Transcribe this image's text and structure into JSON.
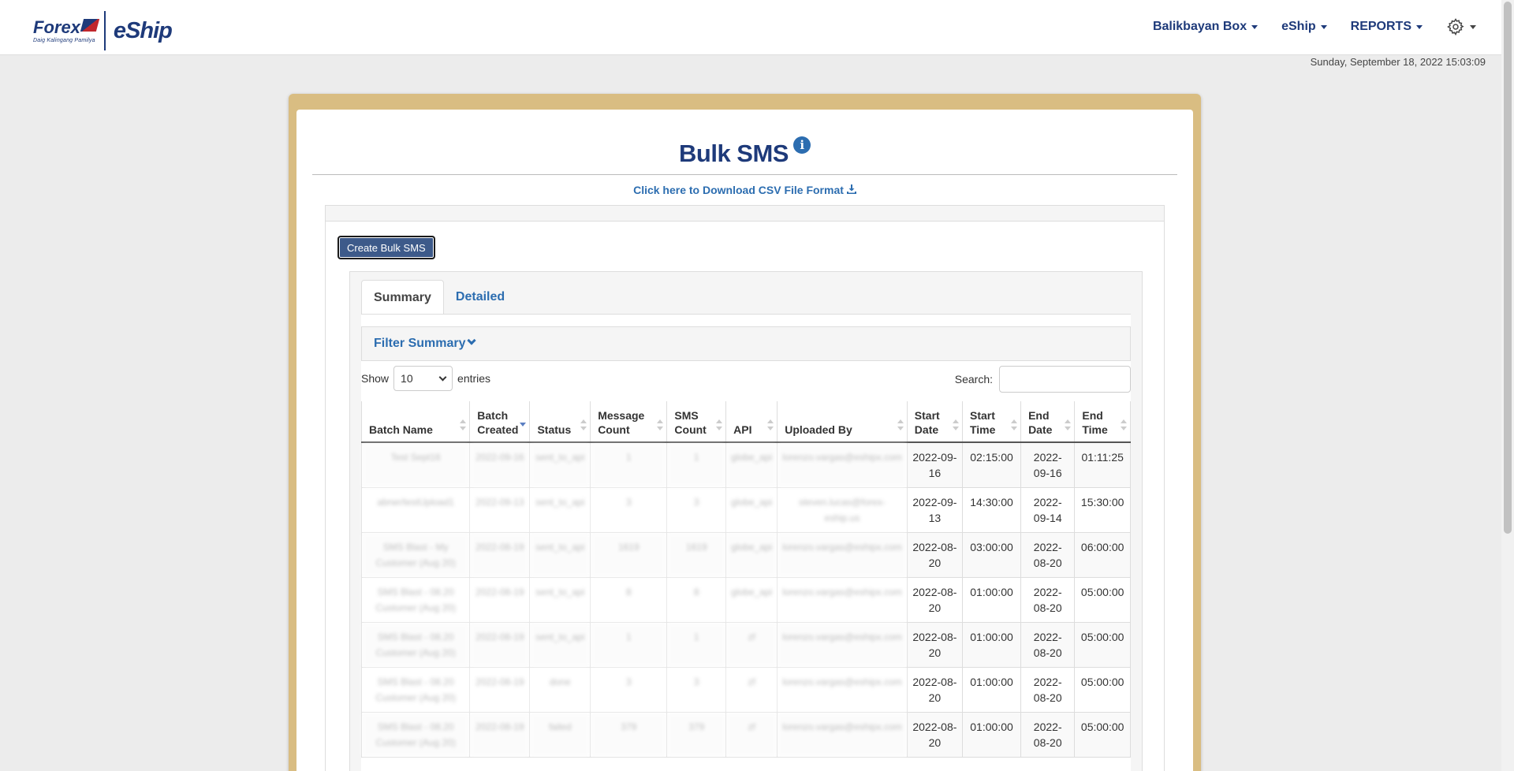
{
  "navbar": {
    "logo_forex": "Forex",
    "logo_tagline": "Daig Kalingang Pamilya",
    "logo_eship": "eShip",
    "menu": [
      {
        "label": "Balikbayan Box"
      },
      {
        "label": "eShip"
      },
      {
        "label": "REPORTS"
      }
    ]
  },
  "datetime": "Sunday, September 18, 2022 15:03:09",
  "page": {
    "title": "Bulk SMS",
    "csv_link": "Click here to Download CSV File Format",
    "create_button": "Create Bulk SMS"
  },
  "tabs": [
    {
      "label": "Summary",
      "active": true
    },
    {
      "label": "Detailed",
      "active": false
    }
  ],
  "filter": {
    "label": "Filter Summary"
  },
  "length_menu": {
    "show": "Show",
    "value": "10",
    "entries": "entries"
  },
  "search": {
    "label": "Search:"
  },
  "table": {
    "columns": [
      {
        "label": "Batch Name"
      },
      {
        "label": "Batch Created"
      },
      {
        "label": "Status"
      },
      {
        "label": "Message Count"
      },
      {
        "label": "SMS Count"
      },
      {
        "label": "API"
      },
      {
        "label": "Uploaded By"
      },
      {
        "label": "Start Date"
      },
      {
        "label": "Start Time"
      },
      {
        "label": "End Date"
      },
      {
        "label": "End Time"
      }
    ],
    "sorted_column": "Batch Created",
    "rows": [
      {
        "batch_name": "Test Sept16",
        "batch_created": "2022-09-16",
        "status": "sent_to_api",
        "message_count": "1",
        "sms_count": "1",
        "api": "globe_api",
        "uploaded_by": "lorenzo.vargas@eshipx.com",
        "start_date": "2022-09-16",
        "start_time": "02:15:00",
        "end_date": "2022-09-16",
        "end_time": "01:11:25"
      },
      {
        "batch_name": "abrwr/testUpload1",
        "batch_created": "2022-09-13",
        "status": "sent_to_api",
        "message_count": "3",
        "sms_count": "3",
        "api": "globe_api",
        "uploaded_by": "steven.lucas@forex-eship.us",
        "start_date": "2022-09-13",
        "start_time": "14:30:00",
        "end_date": "2022-09-14",
        "end_time": "15:30:00"
      },
      {
        "batch_name": "SMS Blast - My Customer (Aug 20)",
        "batch_created": "2022-08-19",
        "status": "sent_to_api",
        "message_count": "1619",
        "sms_count": "1619",
        "api": "globe_api",
        "uploaded_by": "lorenzo.vargas@eshipx.com",
        "start_date": "2022-08-20",
        "start_time": "03:00:00",
        "end_date": "2022-08-20",
        "end_time": "06:00:00"
      },
      {
        "batch_name": "SMS Blast - 08.20 Customer (Aug 20)",
        "batch_created": "2022-08-19",
        "status": "sent_to_api",
        "message_count": "8",
        "sms_count": "8",
        "api": "globe_api",
        "uploaded_by": "lorenzo.vargas@eshipx.com",
        "start_date": "2022-08-20",
        "start_time": "01:00:00",
        "end_date": "2022-08-20",
        "end_time": "05:00:00"
      },
      {
        "batch_name": "SMS Blast - 08.20 Customer (Aug 20)",
        "batch_created": "2022-08-19",
        "status": "sent_to_api",
        "message_count": "1",
        "sms_count": "1",
        "api": "zf",
        "uploaded_by": "lorenzo.vargas@eshipx.com",
        "start_date": "2022-08-20",
        "start_time": "01:00:00",
        "end_date": "2022-08-20",
        "end_time": "05:00:00"
      },
      {
        "batch_name": "SMS Blast - 08.20 Customer (Aug 20)",
        "batch_created": "2022-08-19",
        "status": "done",
        "message_count": "3",
        "sms_count": "3",
        "api": "zf",
        "uploaded_by": "lorenzo.vargas@eshipx.com",
        "start_date": "2022-08-20",
        "start_time": "01:00:00",
        "end_date": "2022-08-20",
        "end_time": "05:00:00"
      },
      {
        "batch_name": "SMS Blast - 08.20 Customer (Aug 20)",
        "batch_created": "2022-08-19",
        "status": "failed",
        "message_count": "379",
        "sms_count": "379",
        "api": "zf",
        "uploaded_by": "lorenzo.vargas@eshipx.com",
        "start_date": "2022-08-20",
        "start_time": "01:00:00",
        "end_date": "2022-08-20",
        "end_time": "05:00:00"
      }
    ]
  }
}
